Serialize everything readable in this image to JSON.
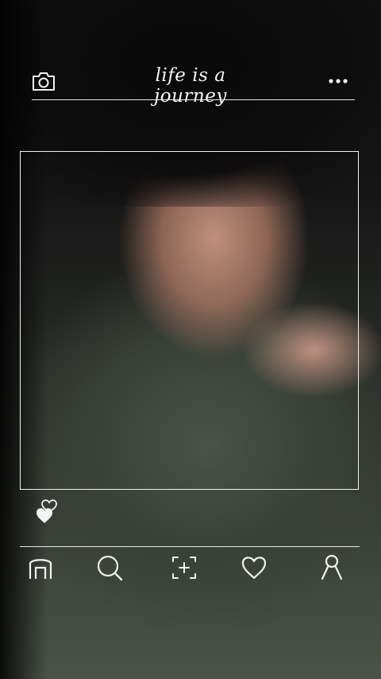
{
  "header": {
    "title": "life is a journey",
    "camera_icon": "camera-icon",
    "more_icon": "more-dots-icon"
  },
  "post": {
    "like_icon": "hearts-icon",
    "liked": true
  },
  "nav": {
    "items": [
      {
        "icon": "home-icon"
      },
      {
        "icon": "search-icon"
      },
      {
        "icon": "add-post-icon"
      },
      {
        "icon": "heart-icon"
      },
      {
        "icon": "profile-icon"
      }
    ]
  },
  "colors": {
    "line": "#e8e8e8",
    "text": "#f5f5f5"
  }
}
